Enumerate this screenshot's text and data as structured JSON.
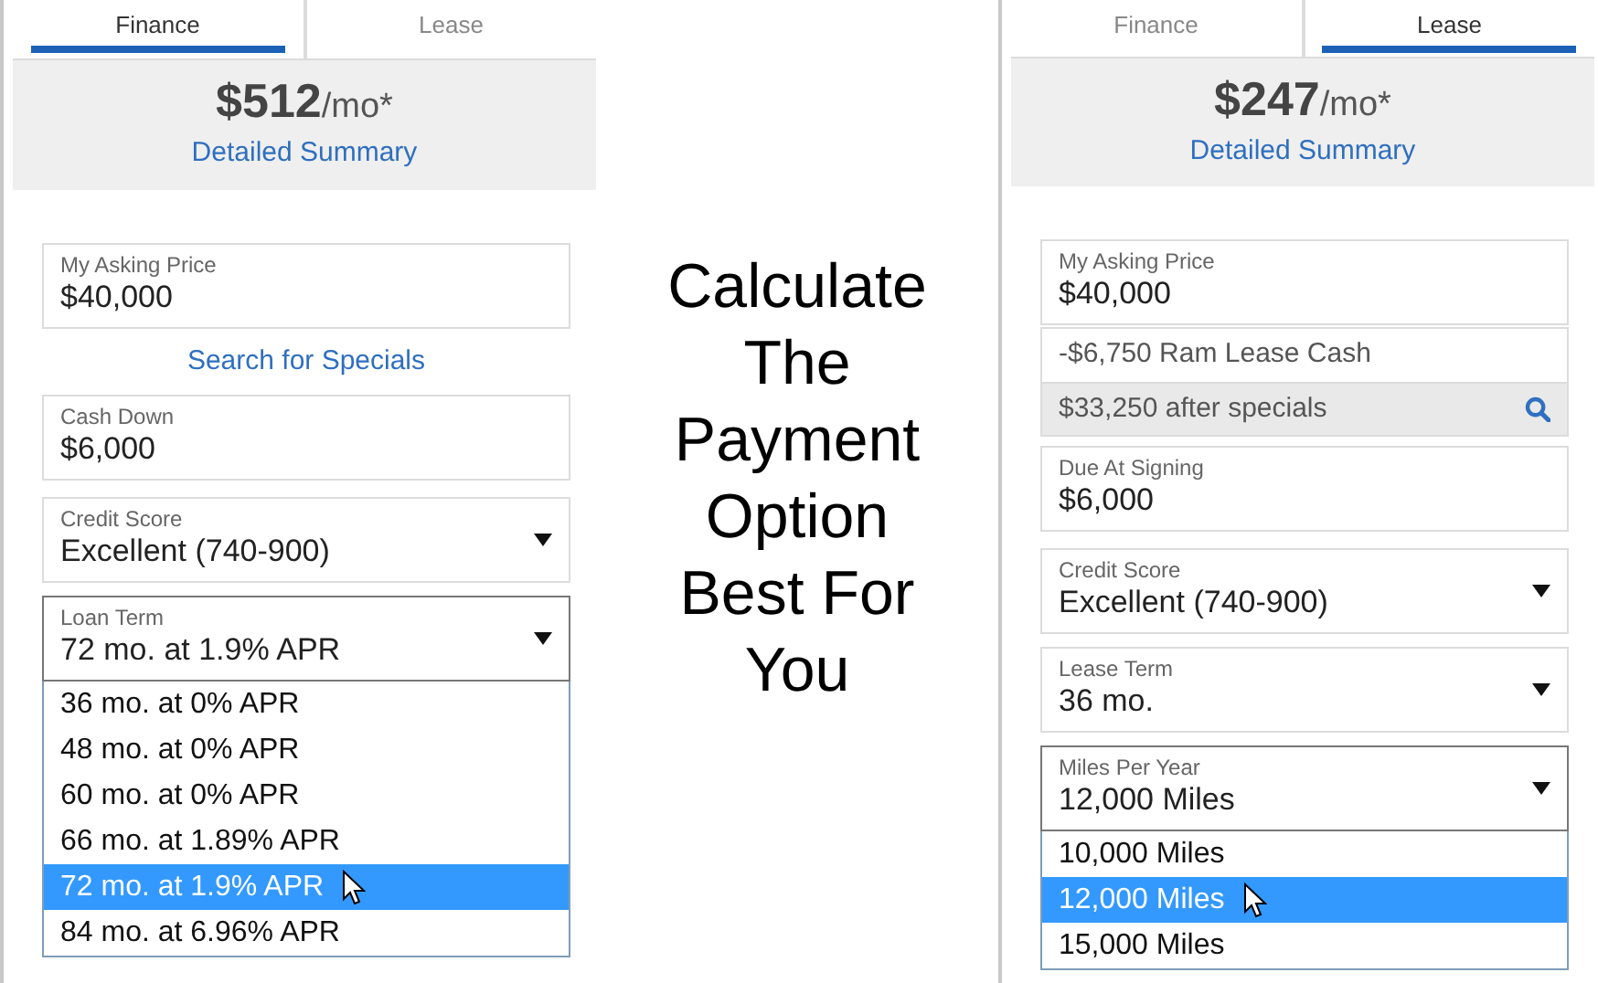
{
  "panels": [
    {
      "tabs": [
        {
          "label": "Finance",
          "selected": true
        },
        {
          "label": "Lease",
          "selected": false
        }
      ],
      "price": "$512",
      "price_suffix": "/mo*",
      "summary_link": "Detailed Summary",
      "fields": [
        {
          "kind": "input",
          "label": "My Asking Price",
          "value": "$40,000"
        },
        {
          "kind": "link",
          "text": "Search for Specials"
        },
        {
          "kind": "input",
          "label": "Cash Down",
          "value": "$6,000"
        },
        {
          "kind": "select",
          "label": "Credit Score",
          "value": "Excellent (740-900)",
          "expanded": false
        },
        {
          "kind": "select",
          "label": "Loan Term",
          "value": "72 mo. at 1.9% APR",
          "expanded": true,
          "options": [
            {
              "label": "36 mo. at 0% APR",
              "selected": false
            },
            {
              "label": "48 mo. at 0% APR",
              "selected": false
            },
            {
              "label": "60 mo. at 0% APR",
              "selected": false
            },
            {
              "label": "66 mo. at 1.89% APR",
              "selected": false
            },
            {
              "label": "72 mo. at 1.9% APR",
              "selected": true
            },
            {
              "label": "84 mo. at 6.96% APR",
              "selected": false
            }
          ]
        }
      ]
    },
    {
      "tabs": [
        {
          "label": "Finance",
          "selected": false
        },
        {
          "label": "Lease",
          "selected": true
        }
      ],
      "price": "$247",
      "price_suffix": "/mo*",
      "summary_link": "Detailed Summary",
      "fields": [
        {
          "kind": "input",
          "label": "My Asking Price",
          "value": "$40,000"
        },
        {
          "kind": "special",
          "text": "-$6,750 Ram Lease Cash"
        },
        {
          "kind": "after",
          "text": "$33,250 after specials"
        },
        {
          "kind": "input",
          "label": "Due At Signing",
          "value": "$6,000"
        },
        {
          "kind": "select",
          "label": "Credit Score",
          "value": "Excellent (740-900)",
          "expanded": false
        },
        {
          "kind": "select",
          "label": "Lease Term",
          "value": "36 mo.",
          "expanded": false
        },
        {
          "kind": "select",
          "label": "Miles Per Year",
          "value": "12,000 Miles",
          "expanded": true,
          "options": [
            {
              "label": "10,000 Miles",
              "selected": false
            },
            {
              "label": "12,000 Miles",
              "selected": true
            },
            {
              "label": "15,000 Miles",
              "selected": false
            }
          ]
        }
      ]
    }
  ],
  "headline": "Calculate\nThe\nPayment\nOption\nBest For\nYou"
}
